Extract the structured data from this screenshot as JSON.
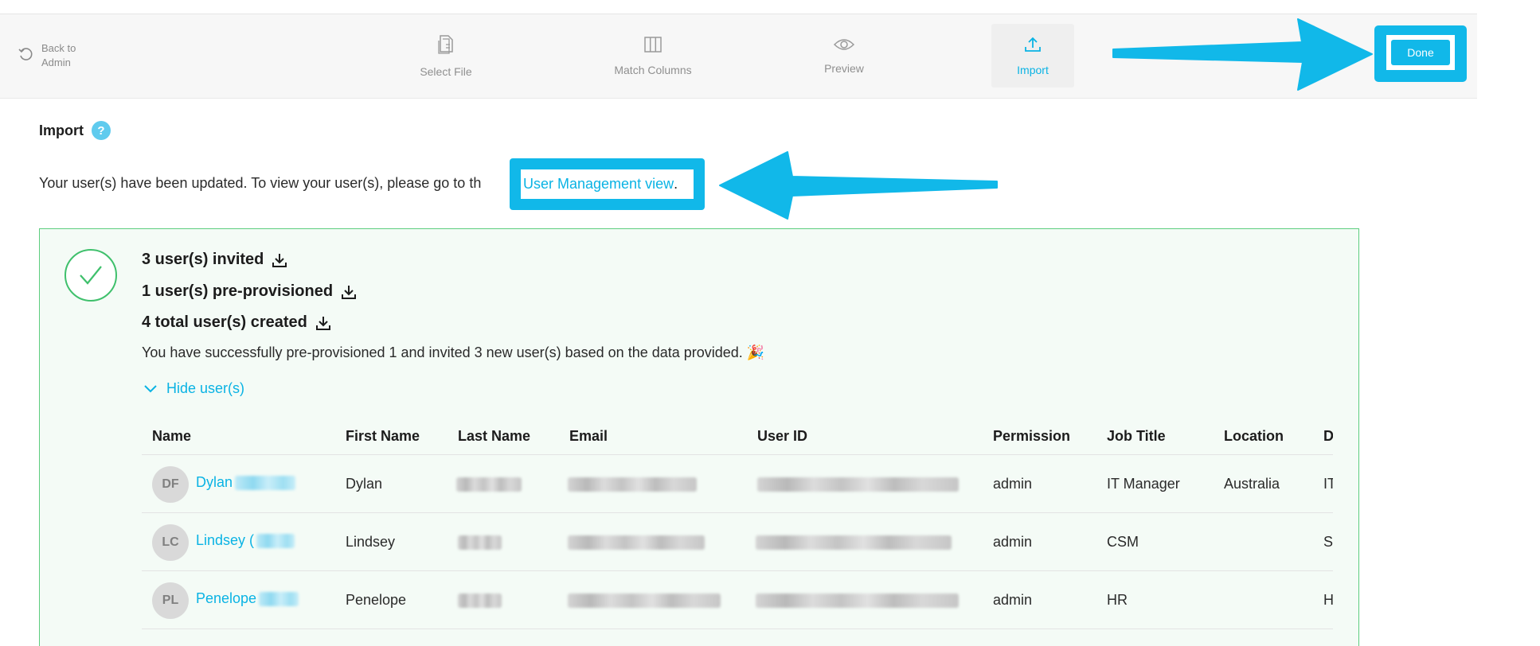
{
  "nav": {
    "back_label": "Back to Admin",
    "steps": [
      {
        "label": "Select File",
        "icon": "file-icon"
      },
      {
        "label": "Match Columns",
        "icon": "columns-icon"
      },
      {
        "label": "Preview",
        "icon": "eye-icon"
      },
      {
        "label": "Import",
        "icon": "upload-icon",
        "active": true
      }
    ],
    "done_label": "Done"
  },
  "import": {
    "title": "Import",
    "help_glyph": "?",
    "message_prefix": "Your user(s) have been updated. To view your user(s), please go to th",
    "link_text": "User Management view",
    "link_suffix": "."
  },
  "result": {
    "stats": [
      "3 user(s) invited",
      "1 user(s) pre-provisioned",
      "4 total user(s) created"
    ],
    "success_message": "You have successfully pre-provisioned 1 and invited 3 new user(s) based on the data provided. 🎉",
    "toggle_label": "Hide user(s)"
  },
  "table": {
    "columns": [
      "Name",
      "First Name",
      "Last Name",
      "Email",
      "User ID",
      "Permission",
      "Job Title",
      "Location",
      "Department"
    ],
    "rows": [
      {
        "initials": "DF",
        "name": "Dylan",
        "first_name": "Dylan",
        "permission": "admin",
        "job_title": "IT Manager",
        "location": "Australia",
        "department": "IT"
      },
      {
        "initials": "LC",
        "name": "Lindsey (",
        "first_name": "Lindsey",
        "permission": "admin",
        "job_title": "CSM",
        "location": "",
        "department": "Success"
      },
      {
        "initials": "PL",
        "name": "Penelope",
        "first_name": "Penelope",
        "permission": "admin",
        "job_title": "HR",
        "location": "",
        "department": "HR"
      }
    ]
  },
  "colors": {
    "accent": "#0ab3e4",
    "annotation": "#11b8e9",
    "success_border": "#5ccd7e",
    "success_check": "#3fc06c"
  }
}
